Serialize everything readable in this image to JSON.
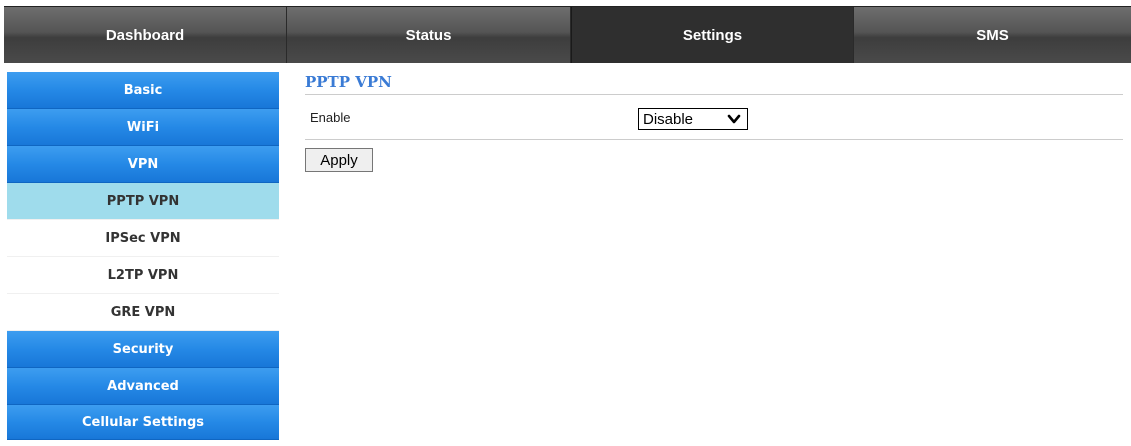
{
  "topnav": {
    "tabs": [
      {
        "label": "Dashboard",
        "active": false
      },
      {
        "label": "Status",
        "active": false
      },
      {
        "label": "Settings",
        "active": true
      },
      {
        "label": "SMS",
        "active": false
      }
    ]
  },
  "sidebar": {
    "items": [
      {
        "label": "Basic",
        "type": "primary"
      },
      {
        "label": "WiFi",
        "type": "primary"
      },
      {
        "label": "VPN",
        "type": "primary"
      },
      {
        "label": "PPTP VPN",
        "type": "sub",
        "selected": true
      },
      {
        "label": "IPSec VPN",
        "type": "sub"
      },
      {
        "label": "L2TP VPN",
        "type": "sub"
      },
      {
        "label": "GRE VPN",
        "type": "sub"
      },
      {
        "label": "Security",
        "type": "primary"
      },
      {
        "label": "Advanced",
        "type": "primary"
      },
      {
        "label": "Cellular Settings",
        "type": "primary"
      }
    ]
  },
  "main": {
    "title": "PPTP VPN",
    "enable_label": "Enable",
    "enable_value": "Disable",
    "apply_label": "Apply"
  },
  "colors": {
    "primary_blue": "#2589e6",
    "selected_sub": "#9fdcec",
    "title_blue": "#3a7bd5",
    "nav_dark": "#2f2f2f"
  }
}
